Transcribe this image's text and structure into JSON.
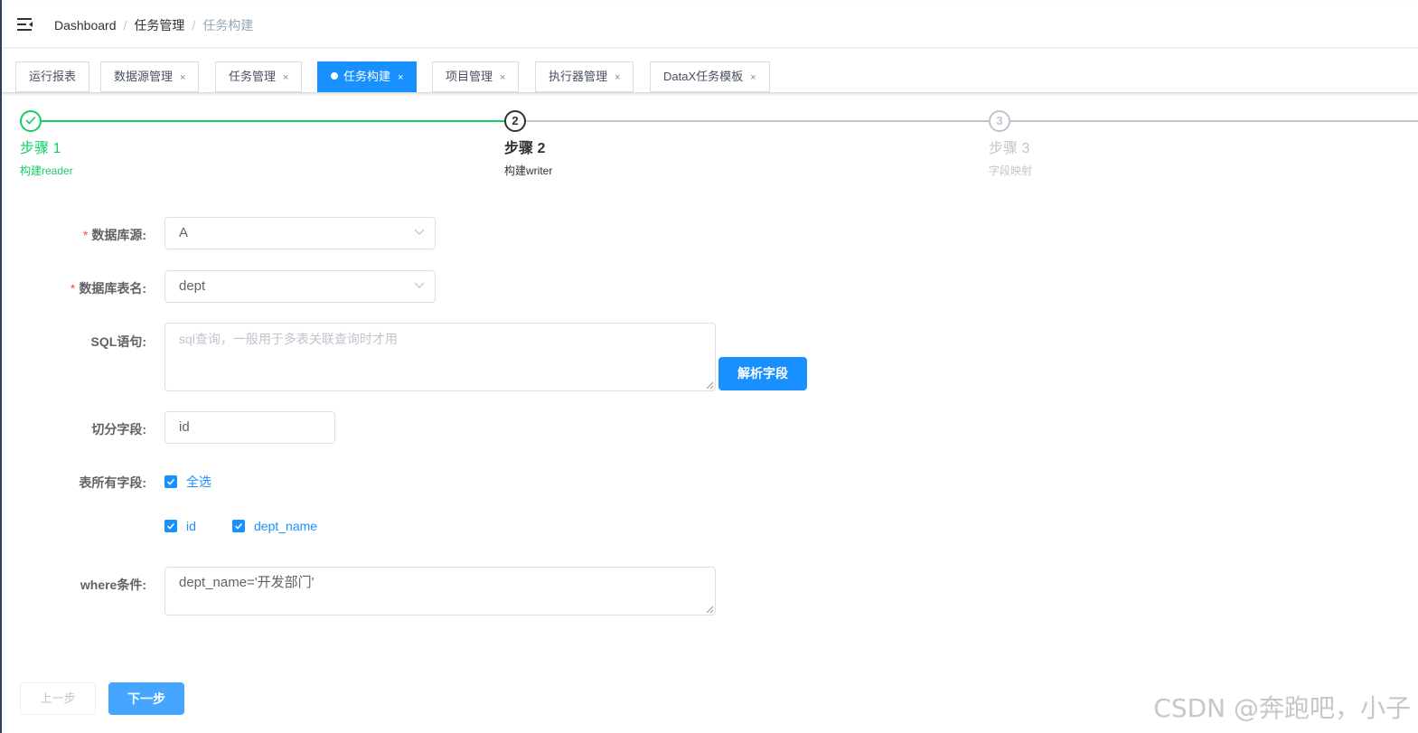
{
  "breadcrumb": [
    "Dashboard",
    "任务管理",
    "任务构建"
  ],
  "tabs": [
    {
      "label": "运行报表",
      "closable": false,
      "active": false
    },
    {
      "label": "数据源管理",
      "closable": true,
      "active": false
    },
    {
      "label": "任务管理",
      "closable": true,
      "active": false
    },
    {
      "label": "任务构建",
      "closable": true,
      "active": true
    },
    {
      "label": "项目管理",
      "closable": true,
      "active": false
    },
    {
      "label": "执行器管理",
      "closable": true,
      "active": false
    },
    {
      "label": "DataX任务模板",
      "closable": true,
      "active": false
    }
  ],
  "tab_close_glyph": "×",
  "steps": [
    {
      "number": "1",
      "title": "步骤 1",
      "desc": "构建reader",
      "status": "success"
    },
    {
      "number": "2",
      "title": "步骤 2",
      "desc": "构建writer",
      "status": "process"
    },
    {
      "number": "3",
      "title": "步骤 3",
      "desc": "字段映射",
      "status": "wait"
    }
  ],
  "form": {
    "datasource_label": "数据库源:",
    "datasource_value": "A",
    "table_label": "数据库表名:",
    "table_value": "dept",
    "sql_label": "SQL语句:",
    "sql_placeholder": "sql查询，一般用于多表关联查询时才用",
    "parse_button": "解析字段",
    "split_label": "切分字段:",
    "split_value": "id",
    "fields_label": "表所有字段:",
    "select_all": "全选",
    "fields": [
      "id",
      "dept_name"
    ],
    "where_label": "where条件:",
    "where_value": "dept_name='开发部门'"
  },
  "footer": {
    "prev": "上一步",
    "next": "下一步"
  },
  "watermark": "CSDN @奔跑吧，小子",
  "colors": {
    "primary": "#1890ff",
    "success": "#13ce66",
    "required": "#ff4949"
  }
}
